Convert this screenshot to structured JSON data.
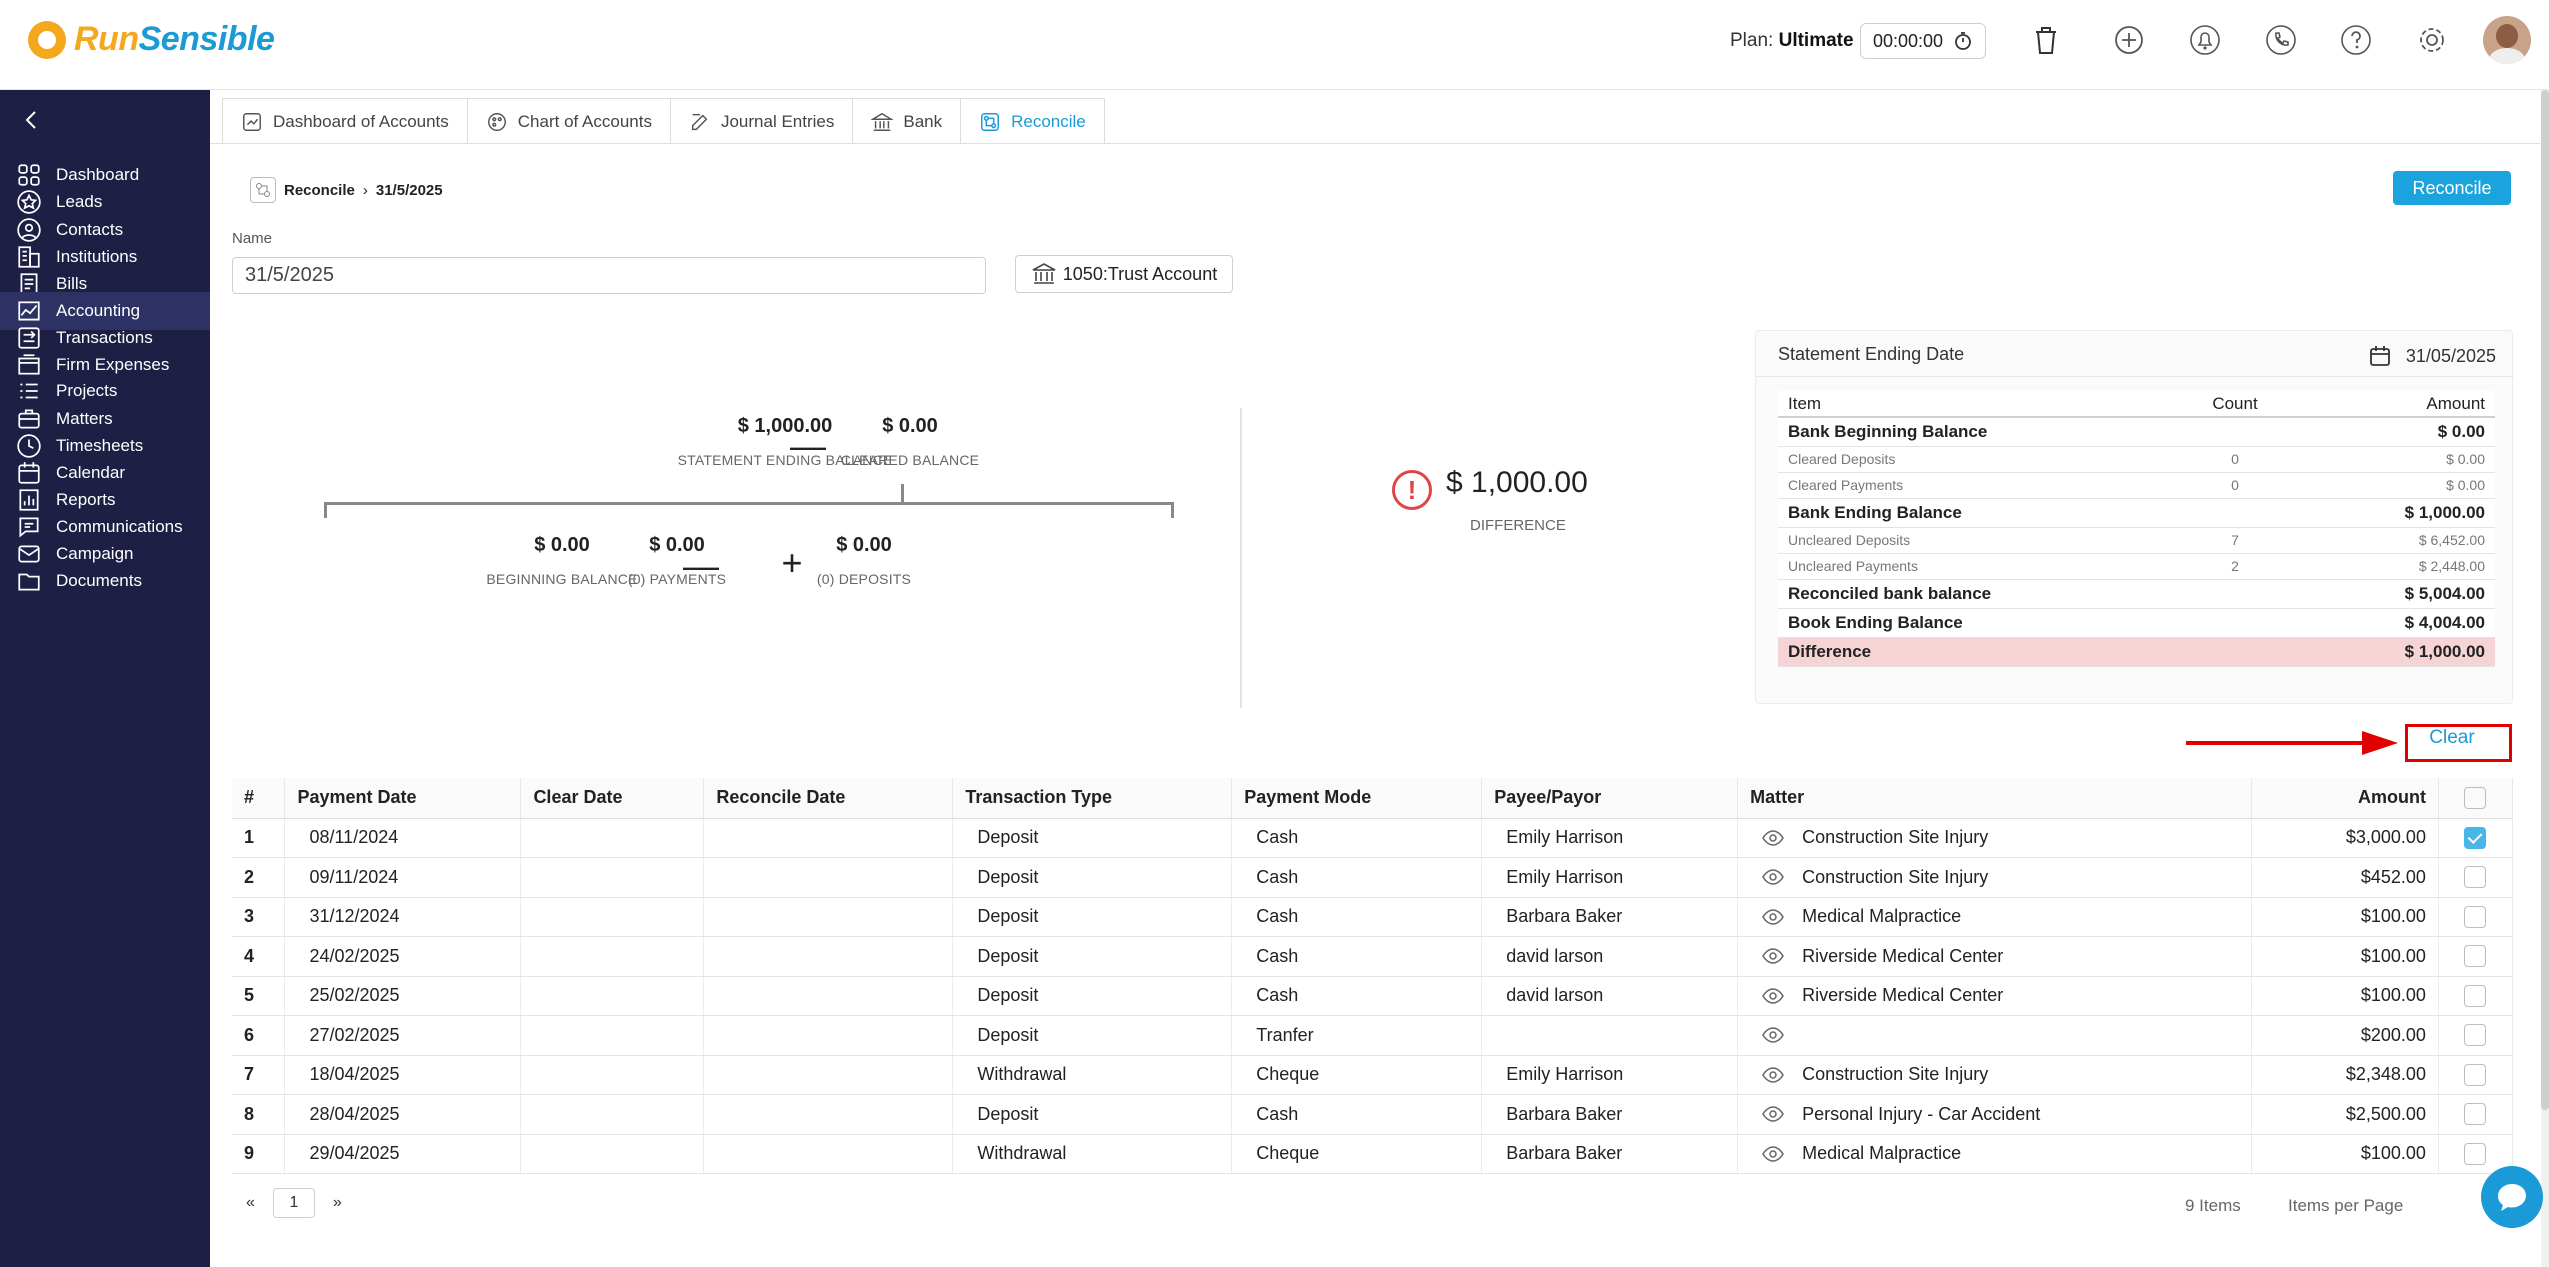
{
  "app": {
    "logo_run": "Run",
    "logo_sensible": "Sensible",
    "plan_prefix": "Plan:",
    "plan_name": "Ultimate",
    "timer": "00:00:00",
    "top_icons": [
      "trash-icon",
      "add-time-icon",
      "bell-icon",
      "phone-icon",
      "help-icon",
      "gear-icon"
    ]
  },
  "sidebar": {
    "items": [
      {
        "label": "Dashboard",
        "icon": "dashboard-icon"
      },
      {
        "label": "Leads",
        "icon": "star-icon"
      },
      {
        "label": "Contacts",
        "icon": "contact-icon"
      },
      {
        "label": "Institutions",
        "icon": "building-icon"
      },
      {
        "label": "Bills",
        "icon": "bill-icon"
      },
      {
        "label": "Accounting",
        "icon": "accounting-icon",
        "active": true
      },
      {
        "label": "Transactions",
        "icon": "transactions-icon"
      },
      {
        "label": "Firm Expenses",
        "icon": "expenses-icon"
      },
      {
        "label": "Projects",
        "icon": "projects-icon"
      },
      {
        "label": "Matters",
        "icon": "briefcase-icon"
      },
      {
        "label": "Timesheets",
        "icon": "clock-icon"
      },
      {
        "label": "Calendar",
        "icon": "calendar-icon"
      },
      {
        "label": "Reports",
        "icon": "report-icon"
      },
      {
        "label": "Communications",
        "icon": "chat-icon"
      },
      {
        "label": "Campaign",
        "icon": "mail-icon"
      },
      {
        "label": "Documents",
        "icon": "folder-icon"
      }
    ]
  },
  "tabs": [
    {
      "label": "Dashboard of Accounts",
      "icon": "chart-icon"
    },
    {
      "label": "Chart of Accounts",
      "icon": "palette-icon"
    },
    {
      "label": "Journal Entries",
      "icon": "edit-icon"
    },
    {
      "label": "Bank",
      "icon": "bank-icon"
    },
    {
      "label": "Reconcile",
      "icon": "reconcile-icon",
      "active": true
    }
  ],
  "breadcrumb": {
    "parent": "Reconcile",
    "current": "31/5/2025"
  },
  "reconcile_button": "Reconcile",
  "form": {
    "name_label": "Name",
    "name_value": "31/5/2025",
    "account": "1050:Trust Account"
  },
  "equation": {
    "statement_ending_balance": "$ 1,000.00",
    "statement_ending_balance_label": "STATEMENT ENDING BALANCE",
    "cleared_balance": "$ 0.00",
    "cleared_balance_label": "CLEARED BALANCE",
    "beginning_balance": "$ 0.00",
    "beginning_balance_label": "BEGINNING BALANCE",
    "payments": "$ 0.00",
    "payments_label": "(0) PAYMENTS",
    "deposits": "$ 0.00",
    "deposits_label": "(0) DEPOSITS",
    "difference": "$ 1,000.00",
    "difference_label": "DIFFERENCE",
    "minus": "—",
    "plus": "+"
  },
  "summary": {
    "title": "Statement Ending Date",
    "date": "31/05/2025",
    "headers": {
      "item": "Item",
      "count": "Count",
      "amount": "Amount"
    },
    "rows": [
      {
        "item": "Bank Beginning Balance",
        "count": "",
        "amount": "$ 0.00",
        "style": "bold"
      },
      {
        "item": "Cleared Deposits",
        "count": "0",
        "amount": "$ 0.00",
        "style": "sub"
      },
      {
        "item": "Cleared Payments",
        "count": "0",
        "amount": "$ 0.00",
        "style": "sub"
      },
      {
        "item": "Bank Ending Balance",
        "count": "",
        "amount": "$ 1,000.00",
        "style": "bold"
      },
      {
        "item": "Uncleared Deposits",
        "count": "7",
        "amount": "$ 6,452.00",
        "style": "sub"
      },
      {
        "item": "Uncleared Payments",
        "count": "2",
        "amount": "$ 2,448.00",
        "style": "sub"
      },
      {
        "item": "Reconciled bank balance",
        "count": "",
        "amount": "$ 5,004.00",
        "style": "bold"
      },
      {
        "item": "Book Ending Balance",
        "count": "",
        "amount": "$ 4,004.00",
        "style": "bold"
      },
      {
        "item": "Difference",
        "count": "",
        "amount": "$ 1,000.00",
        "style": "red"
      }
    ]
  },
  "clear_link": "Clear",
  "table": {
    "headers": [
      "#",
      "Payment Date",
      "Clear Date",
      "Reconcile Date",
      "Transaction Type",
      "Payment Mode",
      "Payee/Payor",
      "Matter",
      "Amount"
    ],
    "rows": [
      {
        "n": "1",
        "payment_date": "08/11/2024",
        "clear_date": "",
        "reconcile_date": "",
        "type": "Deposit",
        "mode": "Cash",
        "payee": "Emily Harrison",
        "matter": "Construction Site Injury",
        "amount": "$3,000.00",
        "checked": true
      },
      {
        "n": "2",
        "payment_date": "09/11/2024",
        "clear_date": "",
        "reconcile_date": "",
        "type": "Deposit",
        "mode": "Cash",
        "payee": "Emily Harrison",
        "matter": "Construction Site Injury",
        "amount": "$452.00",
        "checked": false
      },
      {
        "n": "3",
        "payment_date": "31/12/2024",
        "clear_date": "",
        "reconcile_date": "",
        "type": "Deposit",
        "mode": "Cash",
        "payee": "Barbara Baker",
        "matter": "Medical Malpractice",
        "amount": "$100.00",
        "checked": false
      },
      {
        "n": "4",
        "payment_date": "24/02/2025",
        "clear_date": "",
        "reconcile_date": "",
        "type": "Deposit",
        "mode": "Cash",
        "payee": "david larson",
        "matter": "Riverside Medical Center",
        "amount": "$100.00",
        "checked": false
      },
      {
        "n": "5",
        "payment_date": "25/02/2025",
        "clear_date": "",
        "reconcile_date": "",
        "type": "Deposit",
        "mode": "Cash",
        "payee": "david larson",
        "matter": "Riverside Medical Center",
        "amount": "$100.00",
        "checked": false
      },
      {
        "n": "6",
        "payment_date": "27/02/2025",
        "clear_date": "",
        "reconcile_date": "",
        "type": "Deposit",
        "mode": "Tranfer",
        "payee": "",
        "matter": "",
        "amount": "$200.00",
        "checked": false
      },
      {
        "n": "7",
        "payment_date": "18/04/2025",
        "clear_date": "",
        "reconcile_date": "",
        "type": "Withdrawal",
        "mode": "Cheque",
        "payee": "Emily Harrison",
        "matter": "Construction Site Injury",
        "amount": "$2,348.00",
        "checked": false
      },
      {
        "n": "8",
        "payment_date": "28/04/2025",
        "clear_date": "",
        "reconcile_date": "",
        "type": "Deposit",
        "mode": "Cash",
        "payee": "Barbara Baker",
        "matter": "Personal Injury - Car Accident",
        "amount": "$2,500.00",
        "checked": false
      },
      {
        "n": "9",
        "payment_date": "29/04/2025",
        "clear_date": "",
        "reconcile_date": "",
        "type": "Withdrawal",
        "mode": "Cheque",
        "payee": "Barbara Baker",
        "matter": "Medical Malpractice",
        "amount": "$100.00",
        "checked": false
      }
    ]
  },
  "pagination": {
    "prev": "«",
    "page": "1",
    "next": "»",
    "items": "9 Items",
    "per_page": "Items per Page"
  },
  "colors": {
    "accent": "#1aa3dd",
    "sidebar": "#1d1f45",
    "logo": "#f5a81d",
    "alert": "#e00000",
    "difference_row": "#f6d3d5"
  }
}
